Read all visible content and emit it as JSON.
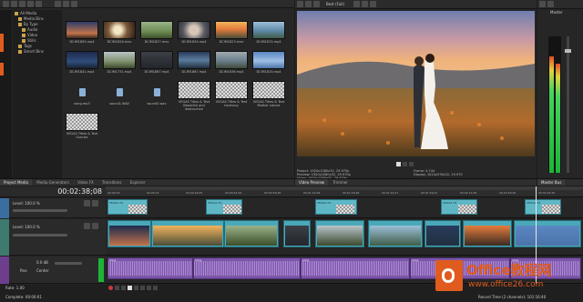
{
  "app": {
    "watermark": "Office教程网",
    "watermark_url": "www.office26.com",
    "colors": {
      "orange_brand": "#e05b1e",
      "clip_teal": "#5fb6c5",
      "clip_purple": "#7b55a8",
      "meter_green": "#1db43a"
    }
  },
  "media_tree": {
    "root": "All Media",
    "items": [
      "Media Bins",
      "By Type",
      "Audio",
      "Video",
      "Stills",
      "Tags",
      "Smart Bins"
    ]
  },
  "media_items": [
    {
      "label": "DCIM1805.mp4",
      "thumb": "thumb-dusk"
    },
    {
      "label": "DCIM1826.mov",
      "thumb": "thumb-ring"
    },
    {
      "label": "DCIM1827.mov",
      "thumb": "thumb-field"
    },
    {
      "label": "DCIM1834.mp4",
      "thumb": "thumb-hands"
    },
    {
      "label": "DCIM1823.mov",
      "thumb": "thumb-sunset"
    },
    {
      "label": "DCIM1841.mp4",
      "thumb": "thumb-coast"
    },
    {
      "label": "DCIM1731.mp4",
      "thumb": "thumb-meadow"
    },
    {
      "label": "DCIM1867.mp4",
      "thumb": "thumb-couple"
    },
    {
      "label": "DCIM1867.mp4",
      "thumb": "thumb-lake"
    },
    {
      "label": "DCIM1836.mp4",
      "thumb": "thumb-beach"
    },
    {
      "label": "DCIM1815.mp4",
      "thumb": "thumb-sky"
    },
    {
      "label": "song.mp3",
      "thumb": "audio"
    },
    {
      "label": "sound1.WAV",
      "thumb": "audio"
    },
    {
      "label": "sound2.wav",
      "thumb": "audio"
    },
    {
      "label": "VEGAS Titles & Text\nBeautiful and destructive",
      "thumb": "checker"
    },
    {
      "label": "VEGAS Titles & Text\nharmony",
      "thumb": "checker"
    },
    {
      "label": "VEGAS Titles & Text\nMother nature",
      "thumb": "checker"
    },
    {
      "label": "VEGAS Titles & Text\nSunrise",
      "thumb": "checker"
    }
  ],
  "bottom_tabs": [
    "Project Media",
    "Media Generators",
    "Video FX",
    "Transitions",
    "Explorer"
  ],
  "preview": {
    "mode": "Best (Full)",
    "tabs": [
      "Video Preview",
      "Trimmer"
    ],
    "info_left": [
      "Project: 1920x1080x32, 29.970p",
      "Preview: 1920x1080x32, 29.970p",
      "Video: 1920x1080x32, 29.970p"
    ],
    "info_right": [
      "Frame: 4,744",
      "Display: 1024x576x32, 29.970"
    ]
  },
  "master": {
    "title": "Master",
    "bus_tab": "Master Bus"
  },
  "timeline": {
    "timecode": "00:02:38;08",
    "ruler": [
      "00:00:00",
      "00:00:15",
      "00:00:29;29",
      "00:00:44;29",
      "00:00:59;28",
      "00:01:14;28",
      "00:01:29;28",
      "00:01:44;27",
      "00:01:59;27",
      "00:02:14;26",
      "00:02:29;26",
      "00:02:44;25"
    ],
    "track1": {
      "level": "Level: 100.0 %"
    },
    "track2": {
      "level": "Level: 100.0 %"
    },
    "audio": {
      "vol": "0.0 dB",
      "pan_label": "Pan:",
      "pan": "Center"
    },
    "clip_prefix": "VEGAS Tit",
    "audio_clip": "song",
    "rate": "Rate: 1.00",
    "status": "Complete: 00:00:01",
    "record_time": "Record Time (2 channels): 101:16:40"
  }
}
